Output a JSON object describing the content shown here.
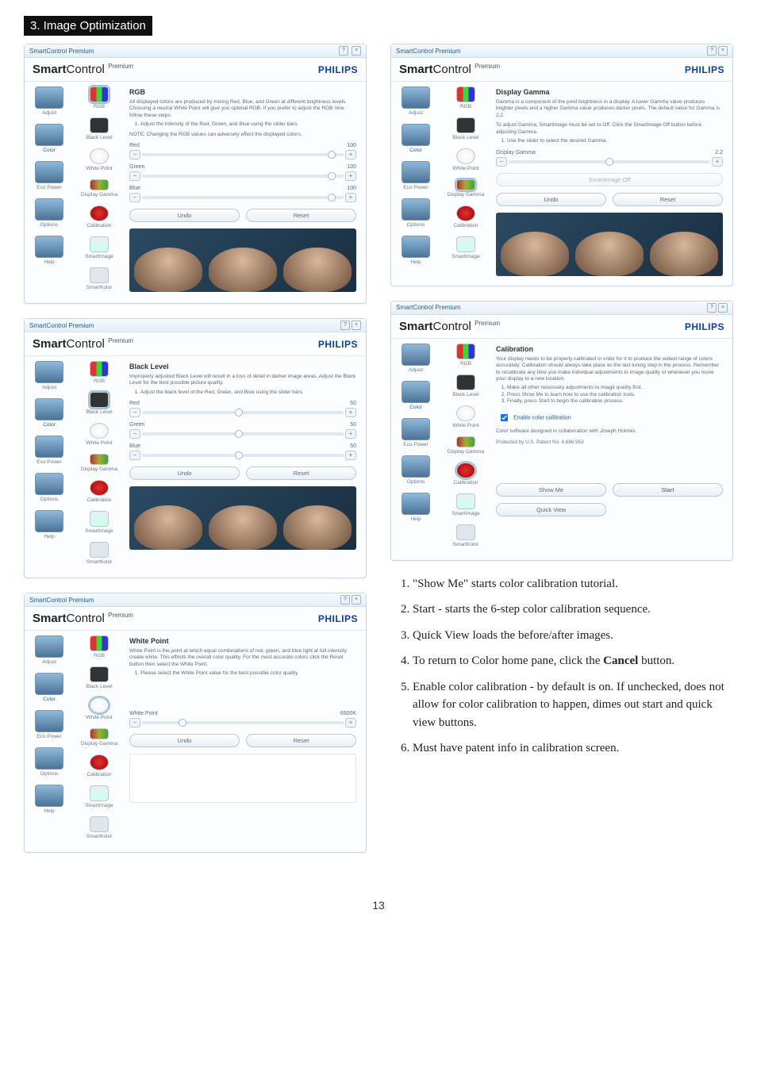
{
  "header": "3. Image Optimization",
  "page_number": "13",
  "app": {
    "title": "SmartControl Premium",
    "brand_prefix": "Smart",
    "brand_mid": "Control",
    "brand_suffix": "Premium",
    "logo": "PHILIPS",
    "help_glyph": "?",
    "close_glyph": "×"
  },
  "nav": {
    "adjust": "Adjust",
    "color": "Color",
    "eco": "Eco Power",
    "options": "Options",
    "help": "Help"
  },
  "subnav": {
    "rgb": "RGB",
    "black": "Black Level",
    "white": "White Point",
    "gamma": "Display Gamma",
    "cal": "Calibration",
    "simg": "SmartImage",
    "skolor": "SmartKolor"
  },
  "buttons": {
    "undo": "Undo",
    "reset": "Reset",
    "show_me": "Show Me",
    "start": "Start",
    "quick_view": "Quick View",
    "si_off": "SmartImage Off"
  },
  "panels": {
    "rgb": {
      "title": "RGB",
      "desc": "All displayed colors are produced by mixing Red, Blue, and Green at different brightness levels. Choosing a neutral White Point will give you optimal RGB. If you prefer to adjust the RGB now, follow these steps:",
      "step1": "Adjust the intensity of the Red, Green, and Blue using the slider bars.",
      "note": "NOTE: Changing the RGB values can adversely effect the displayed colors.",
      "red_lbl": "Red",
      "red_val": "100",
      "green_lbl": "Green",
      "green_val": "100",
      "blue_lbl": "Blue",
      "blue_val": "100"
    },
    "black": {
      "title": "Black Level",
      "desc": "Improperly adjusted Black Level will result in a loss of detail in darker image areas. Adjust the Black Level for the best possible picture quality.",
      "step1": "Adjust the black level of the Red, Green, and Blue using the slider bars.",
      "red_lbl": "Red",
      "red_val": "50",
      "green_lbl": "Green",
      "green_val": "50",
      "blue_lbl": "Blue",
      "blue_val": "50"
    },
    "white": {
      "title": "White Point",
      "desc": "White Point is the point at which equal combinations of red, green, and blue light at full intensity create white. This effects the overall color quality. For the most accurate colors click the Reset button then select the White Point.",
      "step1": "Please select the White Point value for the best possible color quality.",
      "lbl": "White Point",
      "val": "6500K"
    },
    "gamma": {
      "title": "Display Gamma",
      "desc": "Gamma is a component of the pixel brightness in a display. A lower Gamma value produces brighter pixels and a higher Gamma value produces darker pixels. The default value for Gamma is 2.2.",
      "note": "To adjust Gamma, SmartImage must be set to Off. Click the SmartImage Off button before adjusting Gamma.",
      "step1": "Use the slider to select the desired Gamma.",
      "lbl": "Display Gamma",
      "val": "2.2"
    },
    "cal": {
      "title": "Calibration",
      "desc": "Your display needs to be properly calibrated in order for it to produce the widest range of colors accurately. Calibration should always take place as the last tuning step in the process. Remember to recalibrate any time you make individual adjustments to image quality or whenever you move your display to a new location.",
      "s1": "Make all other necessary adjustments to image quality first.",
      "s2": "Press Show Me to learn how to use the calibration tools.",
      "s3": "Finally, press Start to begin the calibration process.",
      "enable": "Enable color calibration",
      "credit": "Color software designed in collaboration with Joseph Holmes.",
      "patent": "Protected by U.S. Patent No. 6,686,953"
    }
  },
  "doc": {
    "i1": "\"Show Me\" starts color calibration tutorial.",
    "i2": "Start - starts the 6-step color calibration sequence.",
    "i3": "Quick View loads the before/after images.",
    "i4a": "To return to Color home pane, click the ",
    "i4b": "Cancel",
    "i4c": " button.",
    "i5": "Enable color calibration - by default is on. If unchecked, does not allow for color calibration to happen, dimes out start and quick view buttons.",
    "i6": "Must have patent info in calibration screen."
  }
}
